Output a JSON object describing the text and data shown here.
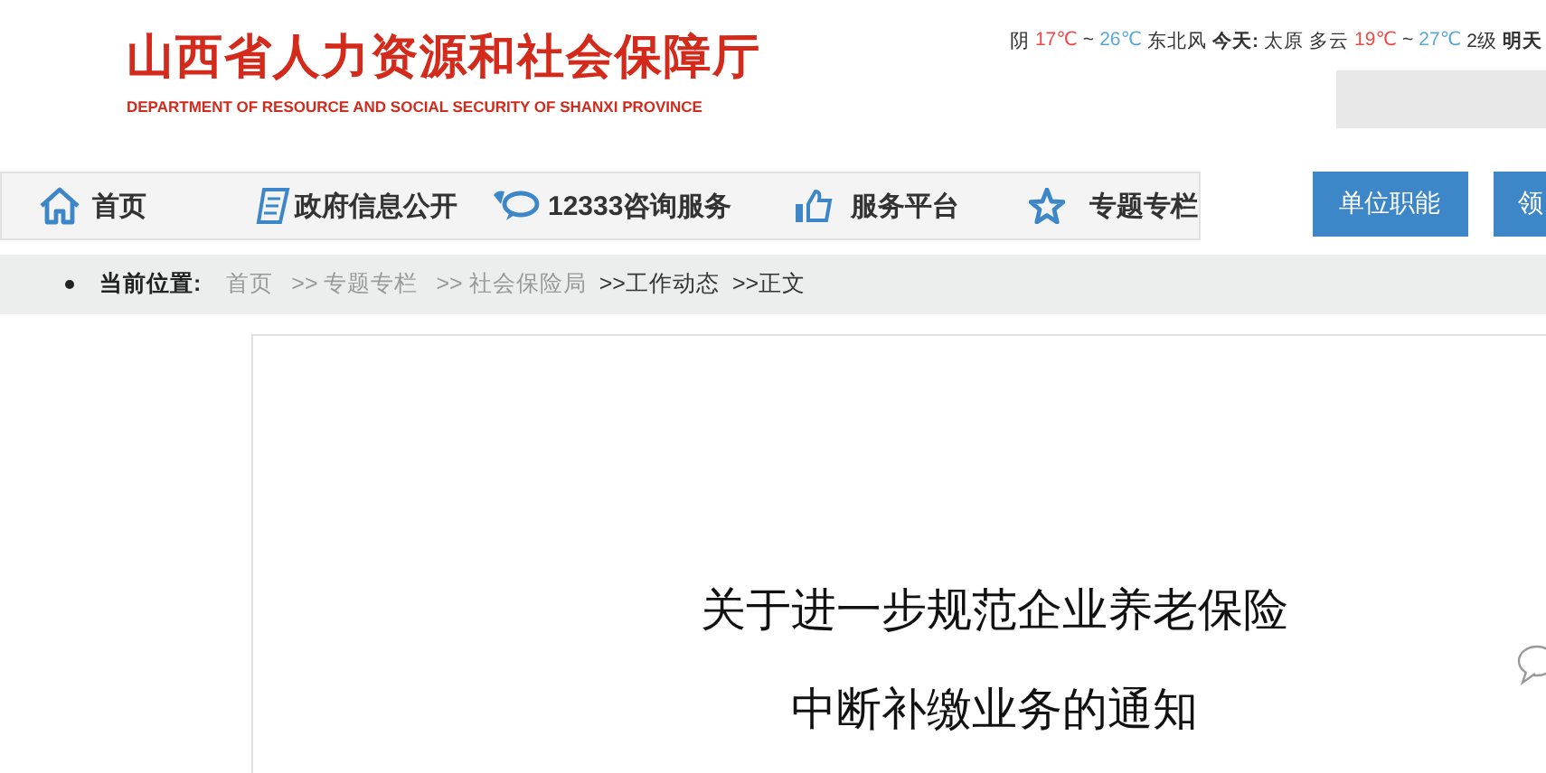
{
  "header": {
    "title": "山西省人力资源和社会保障厅",
    "subtitle": "DEPARTMENT OF RESOURCE AND SOCIAL SECURITY OF SHANXI PROVINCE"
  },
  "weather": [
    {
      "text": "阴",
      "kind": "plain"
    },
    {
      "text": "17℃",
      "kind": "high"
    },
    {
      "text": "~",
      "kind": "plain"
    },
    {
      "text": "26℃",
      "kind": "low"
    },
    {
      "text": "东北风",
      "kind": "plain"
    },
    {
      "text": "今天:",
      "kind": "bold"
    },
    {
      "text": "太原",
      "kind": "plain"
    },
    {
      "text": "多云",
      "kind": "plain"
    },
    {
      "text": "19℃",
      "kind": "high"
    },
    {
      "text": "~",
      "kind": "plain"
    },
    {
      "text": "27℃",
      "kind": "low"
    },
    {
      "text": "2级",
      "kind": "plain"
    },
    {
      "text": "明天",
      "kind": "bold"
    }
  ],
  "nav": [
    {
      "label": "首页",
      "kind": "home"
    },
    {
      "label": "政府信息公开",
      "kind": "document"
    },
    {
      "label": "12333咨询服务",
      "kind": "chat"
    },
    {
      "label": "服务平台",
      "kind": "thumb"
    },
    {
      "label": "专题专栏",
      "kind": "star"
    }
  ],
  "side_buttons": [
    "单位职能",
    "领"
  ],
  "breadcrumb": {
    "label": "当前位置:",
    "items": [
      {
        "text": "首页",
        "current": false
      },
      {
        "text": ">> 专题专栏",
        "current": false
      },
      {
        "text": ">> 社会保险局",
        "current": false
      },
      {
        "text": ">>工作动态",
        "current": true
      },
      {
        "text": ">>正文",
        "current": true
      }
    ]
  },
  "article": {
    "title_lines": [
      "关于进一步规范企业养老保险",
      "中断补缴业务的通知"
    ]
  }
}
